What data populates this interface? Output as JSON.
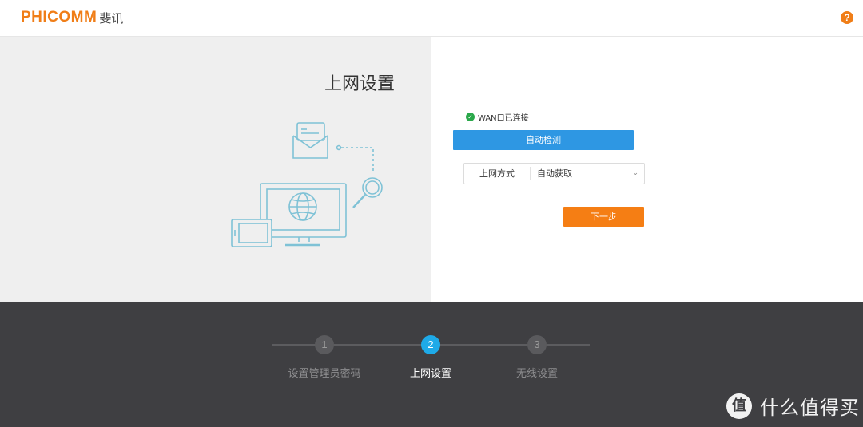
{
  "header": {
    "logo_en": "PHICOMM",
    "logo_cn": "斐讯",
    "help_icon": "question-icon",
    "help_glyph": "?"
  },
  "left": {
    "title": "上网设置"
  },
  "form": {
    "wan_status": "WAN口已连接",
    "auto_detect_label": "自动检测",
    "mode_label": "上网方式",
    "mode_value": "自动获取",
    "next_label": "下一步"
  },
  "stepper": {
    "steps": [
      {
        "number": "1",
        "label": "设置管理员密码",
        "active": false
      },
      {
        "number": "2",
        "label": "上网设置",
        "active": true
      },
      {
        "number": "3",
        "label": "无线设置",
        "active": false
      }
    ]
  },
  "watermark": {
    "logo_glyph": "值",
    "text": "什么值得买"
  },
  "colors": {
    "brand": "#f07e18",
    "primary_button": "#2e97e3",
    "next_button": "#f57e14",
    "active_step": "#1eaae8",
    "success": "#2aa84a",
    "footer_bg": "#3f3f42"
  }
}
